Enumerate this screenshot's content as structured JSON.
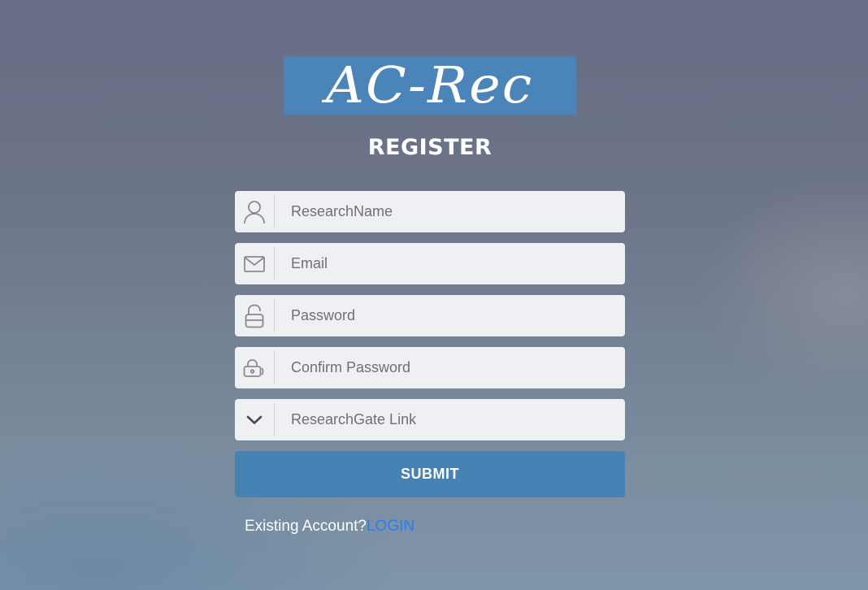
{
  "logo": {
    "text": "AC-Rec",
    "background": "#4a84b8"
  },
  "page": {
    "title": "REGISTER"
  },
  "form": {
    "fields": [
      {
        "icon": "user-icon",
        "placeholder": "ResearchName",
        "value": ""
      },
      {
        "icon": "envelope-icon",
        "placeholder": "Email",
        "value": ""
      },
      {
        "icon": "lock-icon",
        "placeholder": "Password",
        "value": ""
      },
      {
        "icon": "key-lock-icon",
        "placeholder": "Confirm Password",
        "value": ""
      },
      {
        "icon": "chevron-down-icon",
        "placeholder": "ResearchGate Link",
        "value": ""
      }
    ],
    "submit_label": "SUBMIT",
    "submit_color": "#4682b4"
  },
  "footer": {
    "prompt": "Existing Account?",
    "login_label": "LOGIN",
    "link_color": "#2f7cf0"
  }
}
